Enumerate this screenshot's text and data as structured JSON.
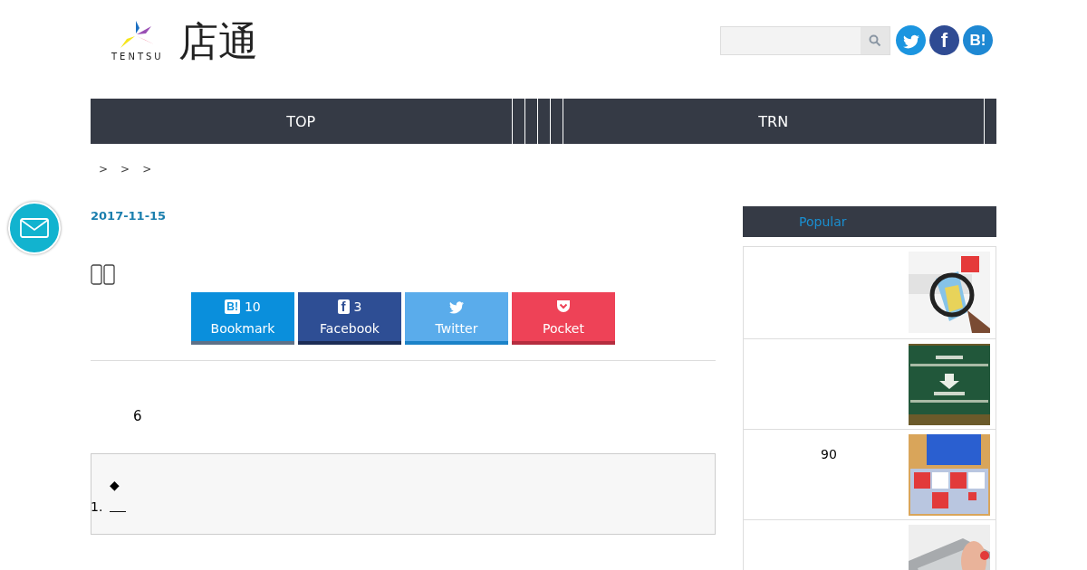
{
  "logo": {
    "wordmark": "TENTSU",
    "title": "店通"
  },
  "social_links": [
    {
      "kind": "twitter"
    },
    {
      "kind": "facebook",
      "glyph": "f"
    },
    {
      "kind": "hatena",
      "glyph": "B!"
    }
  ],
  "nav": [
    {
      "kind": "wide",
      "label": "TOP"
    },
    {
      "kind": "narrow"
    },
    {
      "kind": "narrow"
    },
    {
      "kind": "narrow"
    },
    {
      "kind": "narrow"
    },
    {
      "kind": "wide",
      "label": "TRN"
    },
    {
      "kind": "narrow"
    }
  ],
  "breadcrumbs": [
    ">",
    ">",
    ">"
  ],
  "article": {
    "date": "2017-11-15",
    "share_buttons": [
      {
        "kind": "hatena",
        "glyph": "B!",
        "count": "10",
        "label": "Bookmark"
      },
      {
        "kind": "facebook",
        "glyph": "f",
        "count": "3",
        "label": "Facebook"
      },
      {
        "kind": "twitter",
        "label": "Twitter"
      },
      {
        "kind": "pocket",
        "label": "Pocket"
      }
    ],
    "body_text": "6",
    "toc": {
      "bullet": "◆",
      "items": [
        {
          "number": "1."
        }
      ]
    }
  },
  "sidebar": {
    "heading": "Popular",
    "posts": [
      {
        "kind": "picture"
      },
      {
        "kind": "picture"
      },
      {
        "kind": "picture",
        "text": "90"
      },
      {
        "kind": "picture"
      }
    ]
  }
}
